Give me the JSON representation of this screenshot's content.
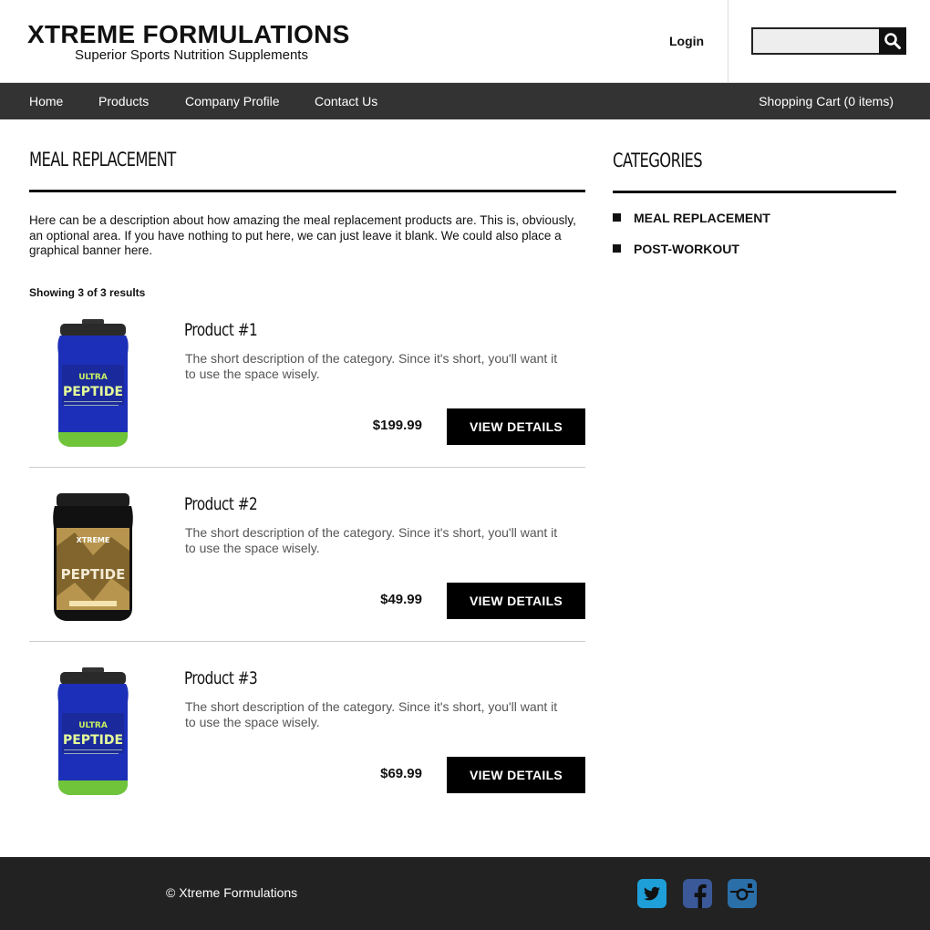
{
  "header": {
    "brand_title": "XTREME FORMULATIONS",
    "brand_tagline": "Superior Sports Nutrition Supplements",
    "login_label": "Login",
    "search_placeholder": "",
    "search_icon": "search-icon"
  },
  "nav": {
    "items": [
      {
        "label": "Home"
      },
      {
        "label": "Products"
      },
      {
        "label": "Company Profile"
      },
      {
        "label": "Contact Us"
      }
    ],
    "cart_label": "Shopping Cart (0 items)"
  },
  "main": {
    "title": "MEAL REPLACEMENT",
    "intro": "Here can be a description about how amazing the meal replacement products are. This is, obviously, an optional area. If you have nothing to put here, we can just leave it blank. We could also place a graphical banner here.",
    "results_count": "Showing 3 of 3 results",
    "products": [
      {
        "name": "Product #1",
        "description": "The short description of the category. Since it's short, you'll want it to use the space wisely.",
        "price": "$199.99",
        "button_label": "VIEW DETAILS",
        "image": "blue-peptide-tub"
      },
      {
        "name": "Product #2",
        "description": "The short description of the category. Since it's short, you'll want it to use the space wisely.",
        "price": "$49.99",
        "button_label": "VIEW DETAILS",
        "image": "gold-peptide-tub"
      },
      {
        "name": "Product #3",
        "description": "The short description of the category. Since it's short, you'll want it to use the space wisely.",
        "price": "$69.99",
        "button_label": "VIEW DETAILS",
        "image": "blue-peptide-tub"
      }
    ]
  },
  "sidebar": {
    "title": "CATEGORIES",
    "categories": [
      {
        "label": "MEAL REPLACEMENT"
      },
      {
        "label": "POST-WORKOUT"
      }
    ]
  },
  "footer": {
    "copyright": "© Xtreme Formulations",
    "social": [
      "twitter-icon",
      "facebook-icon",
      "instagram-icon"
    ]
  },
  "colors": {
    "nav_bg": "#333333",
    "footer_bg": "#222222",
    "button_bg": "#000000",
    "social_blue": "#1e9fd8",
    "social_fb": "#3b5998",
    "social_ig": "#2a6fa8"
  }
}
